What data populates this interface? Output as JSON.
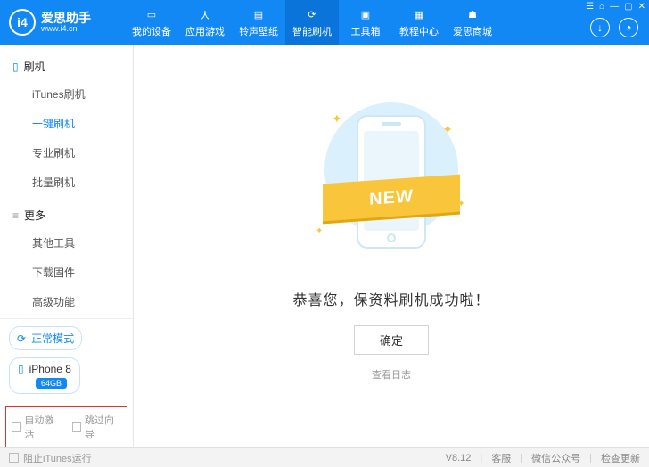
{
  "header": {
    "logo_text": "爱思助手",
    "logo_sub": "www.i4.cn",
    "logo_badge": "i4",
    "nav": [
      {
        "label": "我的设备"
      },
      {
        "label": "应用游戏"
      },
      {
        "label": "铃声壁纸"
      },
      {
        "label": "智能刷机",
        "active": true
      },
      {
        "label": "工具箱"
      },
      {
        "label": "教程中心"
      },
      {
        "label": "爱思商城"
      }
    ]
  },
  "sidebar": {
    "groups": [
      {
        "title": "刷机",
        "items": [
          {
            "label": "iTunes刷机"
          },
          {
            "label": "一键刷机",
            "active": true
          },
          {
            "label": "专业刷机"
          },
          {
            "label": "批量刷机"
          }
        ]
      },
      {
        "title": "更多",
        "items": [
          {
            "label": "其他工具"
          },
          {
            "label": "下载固件"
          },
          {
            "label": "高级功能"
          }
        ]
      }
    ],
    "mode_label": "正常模式",
    "device_name": "iPhone 8",
    "device_badge": "64GB",
    "auto_activate_label": "自动激活",
    "skip_wizard_label": "跳过向导"
  },
  "main": {
    "ribbon_text": "NEW",
    "success_msg": "恭喜您，保资料刷机成功啦！",
    "ok_label": "确定",
    "view_log_label": "查看日志"
  },
  "footer": {
    "block_itunes_label": "阻止iTunes运行",
    "version": "V8.12",
    "support": "客服",
    "wechat": "微信公众号",
    "check_update": "检查更新"
  }
}
